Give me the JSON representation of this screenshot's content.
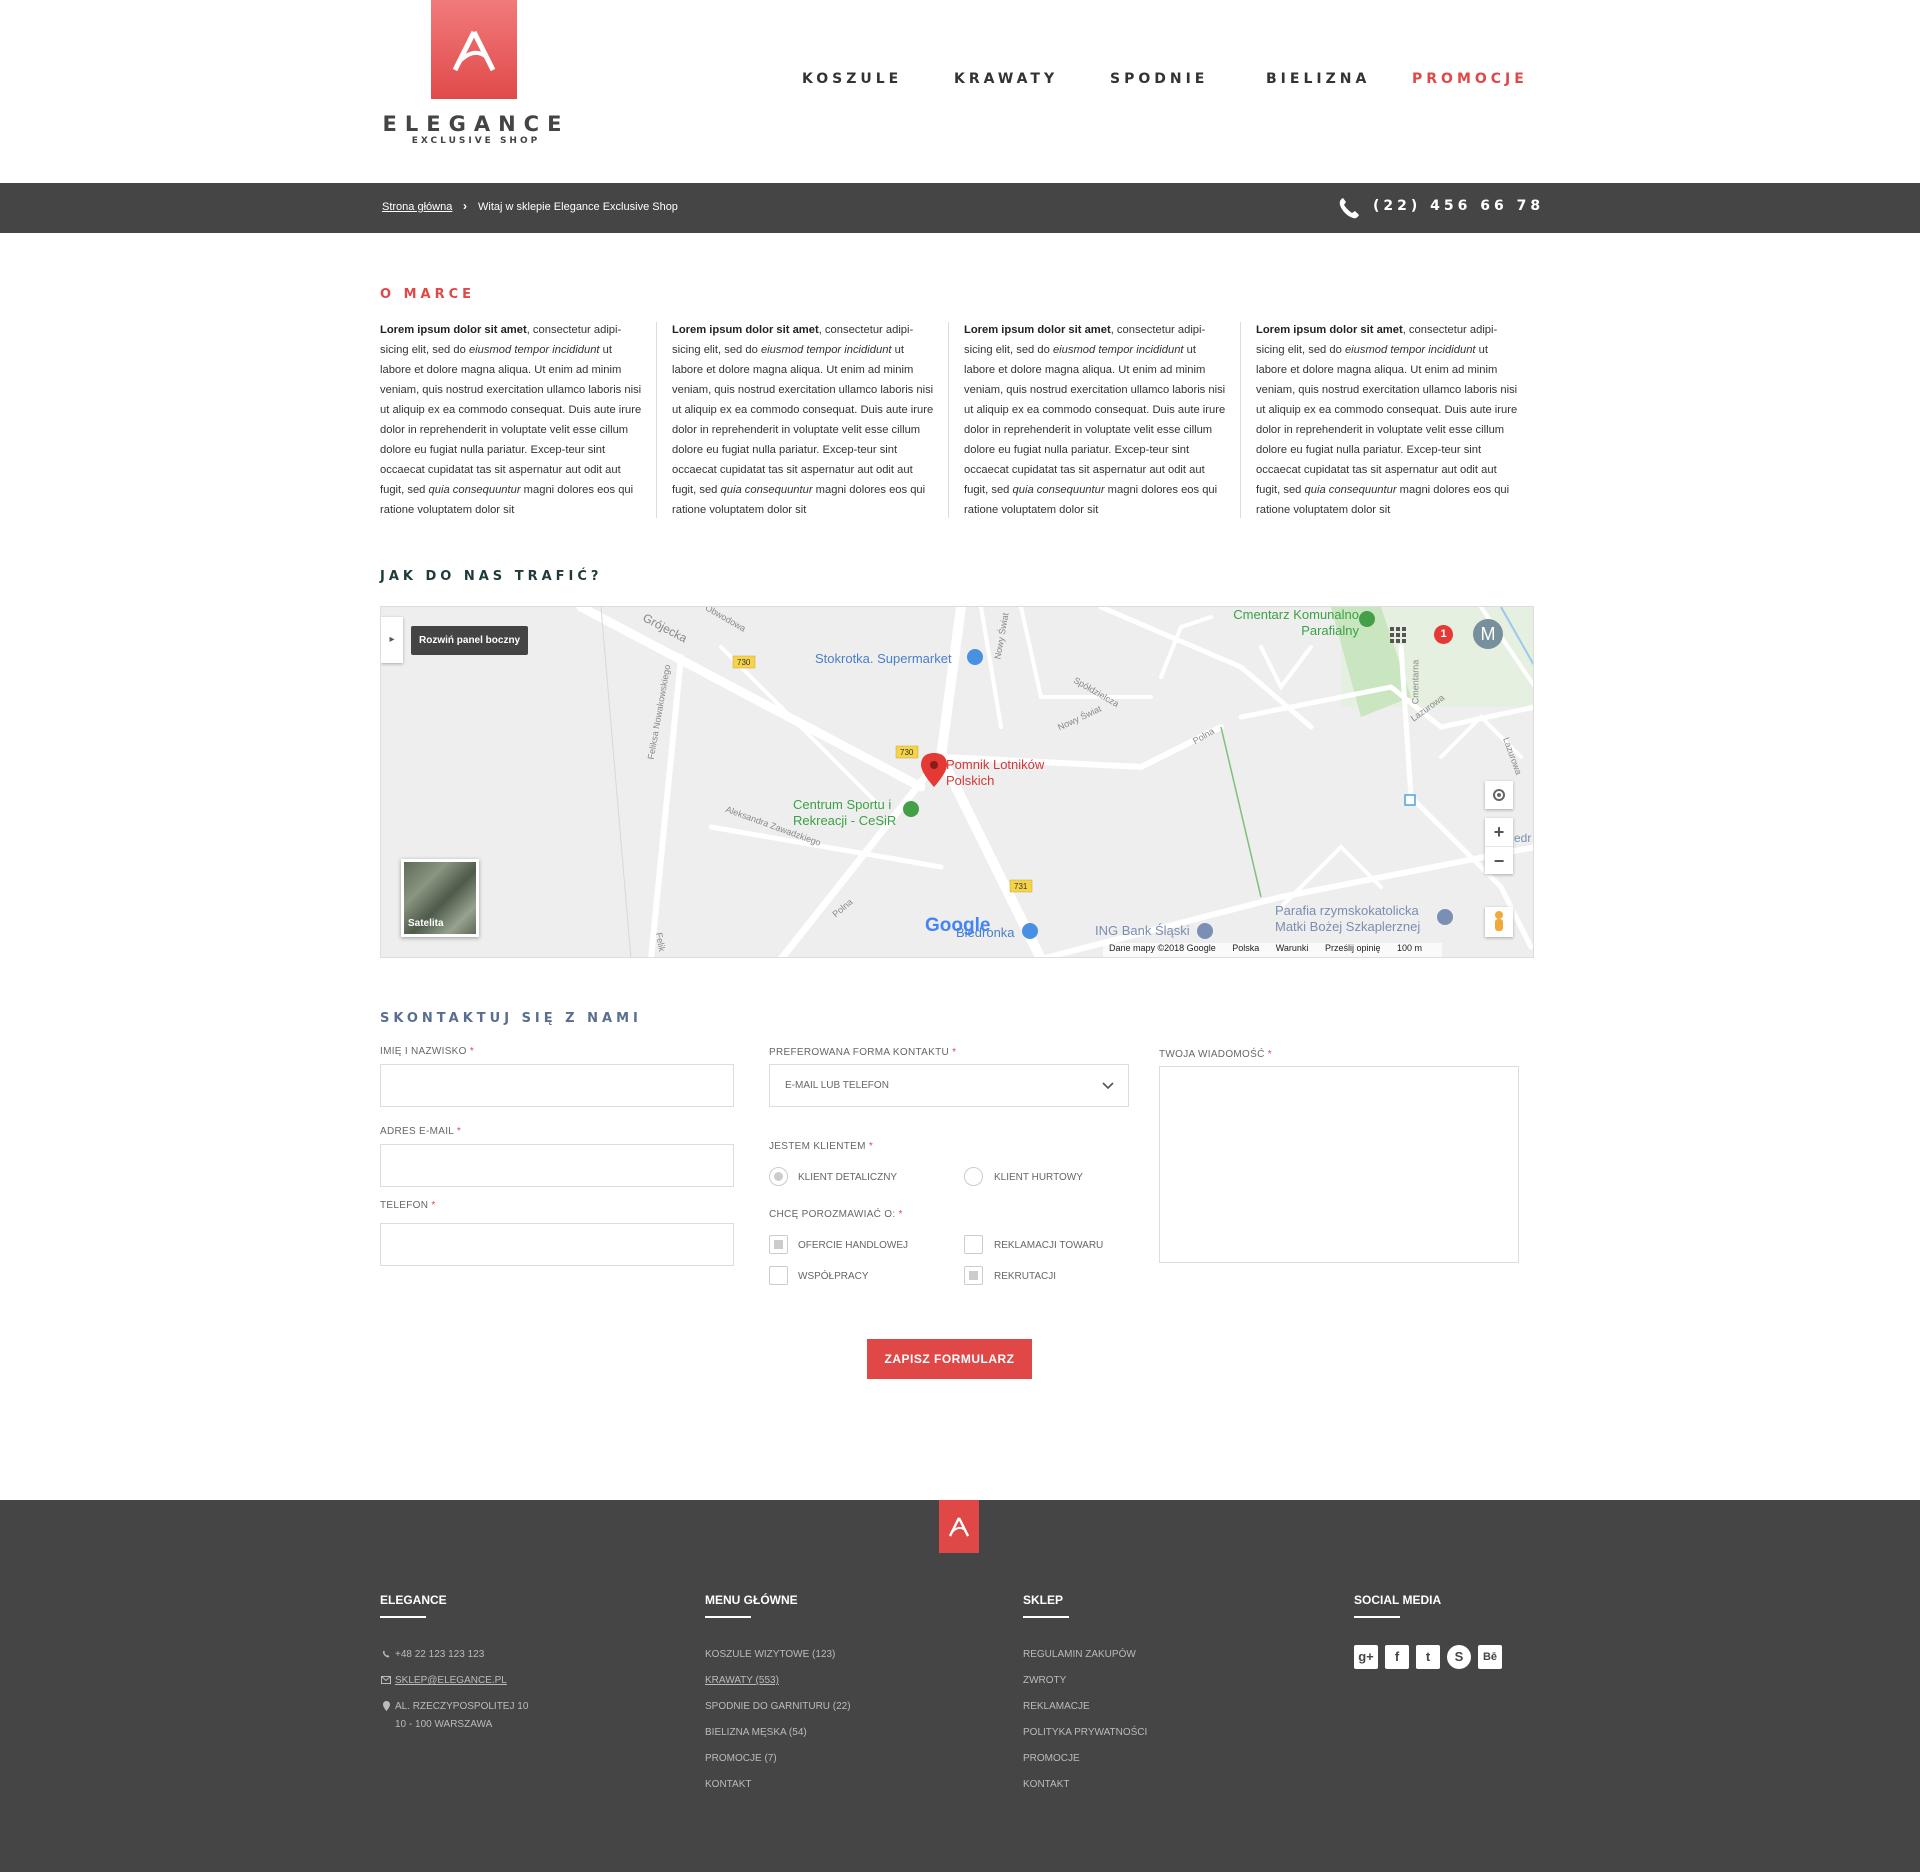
{
  "header": {
    "brand": "ELEGANCE",
    "tagline": "EXCLUSIVE SHOP",
    "nav": [
      "KOSZULE",
      "KRAWATY",
      "SPODNIE",
      "BIELIZNA",
      "PROMOCJE"
    ]
  },
  "breadcrumb": {
    "home": "Strona główna",
    "current": "Witaj w sklepie Elegance Exclusive Shop"
  },
  "phone": "(22) 456 66 78",
  "about": {
    "title": "O MARCE",
    "bold": "Lorem ipsum dolor sit amet",
    "text1": ", consectetur adipi-sicing elit, sed do ",
    "italic1": "eiusmod tempor incididunt",
    "text2": " ut labore et dolore magna aliqua. Ut enim ad minim veniam, quis nostrud exercitation ullamco laboris nisi ut aliquip ex ea commodo consequat. Duis aute irure dolor in reprehenderit in voluptate velit esse cillum dolore eu fugiat nulla pariatur. Excep-teur sint occaecat cupidatat tas sit aspernatur aut odit aut fugit, sed ",
    "italic2": "quia consequuntur",
    "text3": " magni dolores eos qui ratione voluptatem  dolor sit"
  },
  "map": {
    "title": "JAK DO NAS TRAFIĆ?",
    "panel_tip": "Rozwiń panel boczny",
    "satellite": "Satelita",
    "labels": {
      "cemetery": "Cmentarz Komunalno Parafialny",
      "supermarket": "Stokrotka. Supermarket",
      "monument": "Pomnik Lotników Polskich",
      "sport": "Centrum Sportu i Rekreacji - CeSiR",
      "biedronka": "Biedronka",
      "bank": "ING Bank Śląski",
      "parish": "Parafia rzymskokatolicka Matki Bożej Szkaplerznej",
      "street_grojecka": "Grójecka",
      "street_polna": "Polna",
      "street_felikska": "Feliksa Nowakowskiego",
      "street_aleksandra": "Aleksandra Zawadzkiego",
      "street_lazurowa": "Lazurowa",
      "street_cmentarna": "Cmentarna",
      "street_spoldzielcza": "Spółdzielcza",
      "street_nowyswiat": "Nowy Świat",
      "street_obwodowa": "Obwodowa",
      "street_felik": "Felik",
      "route_730a": "730",
      "route_730b": "730",
      "route_731": "731",
      "edge_text": "edr"
    },
    "badge": "1",
    "avatar": "M",
    "google": "Google",
    "footer": [
      "Dane mapy ©2018 Google",
      "Polska",
      "Warunki",
      "Prześlij opinię",
      "100 m"
    ]
  },
  "contact": {
    "title": "SKONTAKTUJ SIĘ Z NAMI",
    "name_label": "IMIĘ I NAZWISKO",
    "email_label": "ADRES  E-MAIL",
    "phone_label": "TELEFON",
    "pref_label": "PREFEROWANA FORMA KONTAKTU",
    "pref_value": "E-MAIL LUB TELEFON",
    "client_label": "JESTEM KLIENTEM",
    "client_options": [
      "KLIENT DETALICZNY",
      "KLIENT HURTOWY"
    ],
    "topic_label": "CHCĘ POROZMAWIAĆ O:",
    "topic_options": [
      "OFERCIE HANDLOWEJ",
      "REKLAMACJI TOWARU",
      "WSPÓŁPRACY",
      "REKRUTACJI"
    ],
    "message_label": "TWOJA WIADOMOŚĆ",
    "req": "*",
    "submit": "ZAPISZ FORMULARZ"
  },
  "footer": {
    "col1": {
      "title": "ELEGANCE",
      "phone": "+48 22 123 123 123",
      "email": "SKLEP@ELEGANCE.PL",
      "addr1": "AL. RZECZYPOSPOLITEJ 10",
      "addr2": "10 - 100 WARSZAWA"
    },
    "col2": {
      "title": "MENU GŁÓWNE",
      "items": [
        "KOSZULE  WIZYTOWE (123)",
        "KRAWATY (553)",
        "SPODNIE DO GARNITURU (22)",
        "BIELIZNA MĘSKA (54)",
        "PROMOCJE (7)",
        "KONTAKT"
      ]
    },
    "col3": {
      "title": "SKLEP",
      "items": [
        "REGULAMIN ZAKUPÓW",
        "ZWROTY",
        "REKLAMACJE",
        "POLITYKA PRYWATNOŚCI",
        "PROMOCJE",
        "KONTAKT"
      ]
    },
    "col4": {
      "title": "SOCIAL MEDIA",
      "icons": [
        "google-plus-icon",
        "facebook-icon",
        "twitter-icon",
        "skype-icon",
        "behance-icon"
      ],
      "glyphs": [
        "g+",
        "f",
        "t",
        "S",
        "Bē"
      ]
    }
  },
  "colors": {
    "accent": "#e04848",
    "dark": "#454545",
    "map_title": "#1f3a3a",
    "contact_title": "#5a6f8f"
  }
}
